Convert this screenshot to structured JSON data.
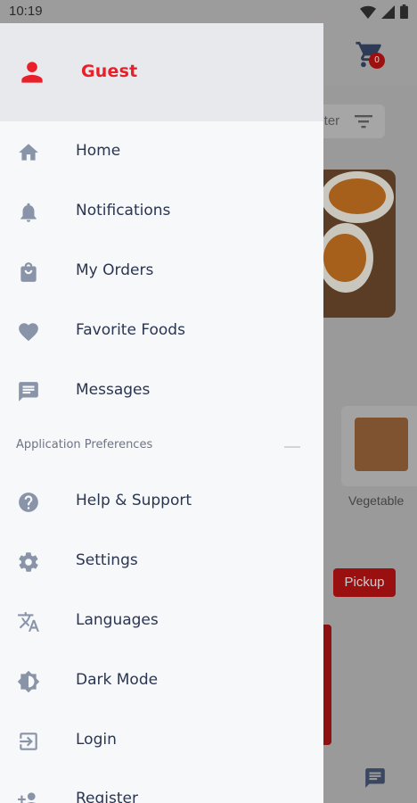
{
  "status_bar": {
    "time": "10:19"
  },
  "drawer": {
    "user": {
      "name": "Guest"
    },
    "primary_items": [
      {
        "label": "Home",
        "icon": "home-icon"
      },
      {
        "label": "Notifications",
        "icon": "bell-icon"
      },
      {
        "label": "My Orders",
        "icon": "shopping-bag-icon"
      },
      {
        "label": "Favorite Foods",
        "icon": "heart-icon"
      },
      {
        "label": "Messages",
        "icon": "chat-icon"
      }
    ],
    "section_title": "Application Preferences",
    "preference_items": [
      {
        "label": "Help & Support",
        "icon": "help-icon"
      },
      {
        "label": "Settings",
        "icon": "gear-icon"
      },
      {
        "label": "Languages",
        "icon": "translate-icon"
      },
      {
        "label": "Dark Mode",
        "icon": "brightness-icon"
      },
      {
        "label": "Login",
        "icon": "login-icon"
      },
      {
        "label": "Register",
        "icon": "add-person-icon"
      }
    ]
  },
  "background": {
    "cart_count": "0",
    "filter_label": "ilter",
    "product_label": "Vegetable",
    "pickup_label": "Pickup"
  },
  "colors": {
    "accent": "#e8202a",
    "icon": "#8a94a8",
    "text": "#2a3552"
  }
}
